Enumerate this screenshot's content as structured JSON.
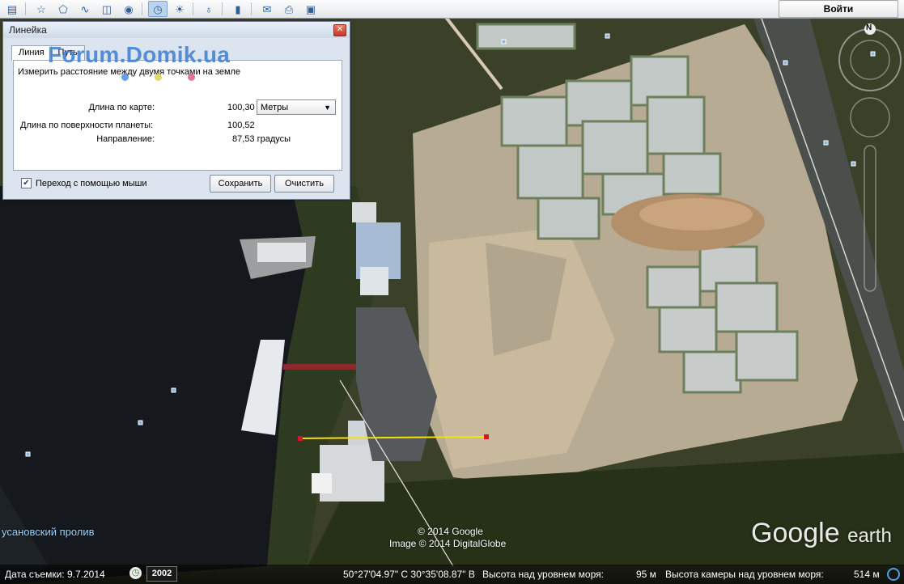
{
  "toolbar": {
    "buttons": [
      {
        "icon": "sidebar-icon"
      },
      {
        "icon": "placemark-icon"
      },
      {
        "icon": "polygon-icon"
      },
      {
        "icon": "path-icon"
      },
      {
        "icon": "image-overlay-icon"
      },
      {
        "icon": "record-tour-icon"
      },
      {
        "icon": "historical-imagery-icon",
        "active": true
      },
      {
        "icon": "sunlight-icon"
      },
      {
        "icon": "planets-icon"
      },
      {
        "icon": "ruler-icon"
      },
      {
        "icon": "email-icon"
      },
      {
        "icon": "print-icon"
      },
      {
        "icon": "save-image-icon"
      }
    ],
    "signin_label": "Войти"
  },
  "ruler": {
    "title": "Линейка",
    "tabs": [
      "Линия",
      "Путь"
    ],
    "prompt": "Измерить расстояние между двумя точками на земле",
    "map_length_label": "Длина по карте:",
    "map_length_value": "100,30",
    "units": "Метры",
    "ground_length_label": "Длина по поверхности планеты:",
    "ground_length_value": "100,52",
    "heading_label": "Направление:",
    "heading_value": "87,53 градусы",
    "mouse_nav_label": "Переход с помощью мыши",
    "mouse_nav_checked": true,
    "save_label": "Сохранить",
    "clear_label": "Очистить"
  },
  "watermark": "Forum.Domik.ua",
  "map": {
    "place_label": "усановский пролив",
    "compass_north": "N",
    "copyright_1": "© 2014 Google",
    "copyright_2": "Image © 2014 DigitalGlobe",
    "logo_main": "Google",
    "logo_sub": "earth",
    "measure_color": "#f5e10a",
    "measure_endpoint_color": "#e0141e"
  },
  "status": {
    "imagery_date": "Дата съемки: 9.7.2014",
    "year": "2002",
    "coords": "50°27'04.97\" С  30°35'08.87\" В",
    "elevation_label": "Высота над уровнем моря:",
    "elevation_value": "95 м",
    "eye_alt_label": "Высота камеры над уровнем моря:",
    "eye_alt_value": "514 м"
  }
}
